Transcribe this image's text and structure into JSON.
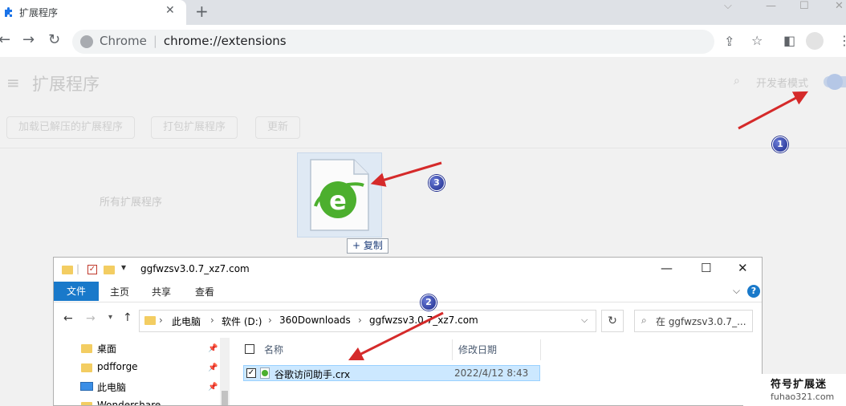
{
  "colors": {
    "arrow": "#d52a2a",
    "callout": "#1c2a8c",
    "accent": "#1979ca",
    "ie_green": "#4caf2e"
  },
  "browser": {
    "tab_title": "扩展程序",
    "tab_icon": "puzzle-icon",
    "new_tab": "+",
    "omnibox_app": "Chrome",
    "omnibox_url": "chrome://extensions"
  },
  "extensions": {
    "title": "扩展程序",
    "dev_mode_label": "开发者模式",
    "load_unpacked": "加载已解压的扩展程序",
    "pack_extension": "打包扩展程序",
    "update": "更新",
    "all_extensions": "所有扩展程序"
  },
  "drag": {
    "copy_label": "+ 复制"
  },
  "callouts": [
    "1",
    "2",
    "3"
  ],
  "explorer": {
    "window_title": "ggfwzsv3.0.7_xz7.com",
    "ribbon_tabs": [
      "文件",
      "主页",
      "共享",
      "查看"
    ],
    "breadcrumbs": [
      "此电脑",
      "软件 (D:)",
      "360Downloads",
      "ggfwzsv3.0.7_xz7.com"
    ],
    "search_placeholder": "在 ggfwzsv3.0.7_...",
    "nav_items": [
      "桌面",
      "pdfforge",
      "此电脑",
      "Wondershare"
    ],
    "columns": {
      "name": "名称",
      "modified": "修改日期"
    },
    "file": {
      "name": "谷歌访问助手.crx",
      "modified": "2022/4/12 8:43"
    }
  },
  "watermark": {
    "line1": "符号扩展迷",
    "line2": "fuhao321.com"
  }
}
